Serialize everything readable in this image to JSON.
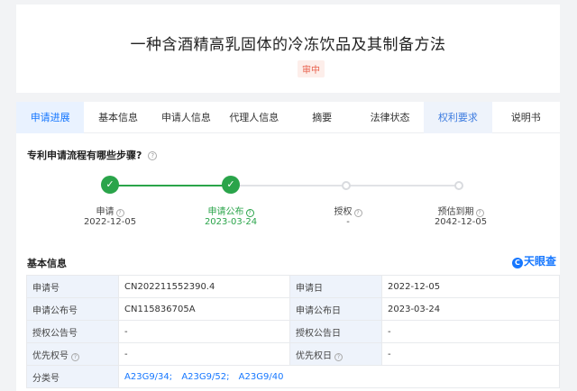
{
  "header": {
    "title": "一种含酒精高乳固体的冷冻饮品及其制备方法",
    "status": "审中"
  },
  "tabs": [
    {
      "label": "申请进展"
    },
    {
      "label": "基本信息"
    },
    {
      "label": "申请人信息"
    },
    {
      "label": "代理人信息"
    },
    {
      "label": "摘要"
    },
    {
      "label": "法律状态"
    },
    {
      "label": "权利要求"
    },
    {
      "label": "说明书"
    }
  ],
  "progress": {
    "question": "专利申请流程有哪些步骤?",
    "steps": [
      {
        "label": "申请",
        "date": "2022-12-05"
      },
      {
        "label": "申请公布",
        "date": "2023-03-24"
      },
      {
        "label": "授权",
        "date": "-"
      },
      {
        "label": "预估到期",
        "date": "2042-12-05"
      }
    ]
  },
  "basic": {
    "title": "基本信息",
    "brand": "天眼查",
    "rows": [
      {
        "l1": "申请号",
        "v1": "CN202211552390.4",
        "l2": "申请日",
        "v2": "2022-12-05"
      },
      {
        "l1": "申请公布号",
        "v1": "CN115836705A",
        "l2": "申请公布日",
        "v2": "2023-03-24"
      },
      {
        "l1": "授权公告号",
        "v1": "-",
        "l2": "授权公告日",
        "v2": "-"
      },
      {
        "l1": "优先权号",
        "v1": "-",
        "l2": "优先权日",
        "v2": "-"
      },
      {
        "l1": "分类号",
        "links": [
          "A23G9/34;",
          "A23G9/52;",
          "A23G9/40"
        ]
      }
    ]
  }
}
